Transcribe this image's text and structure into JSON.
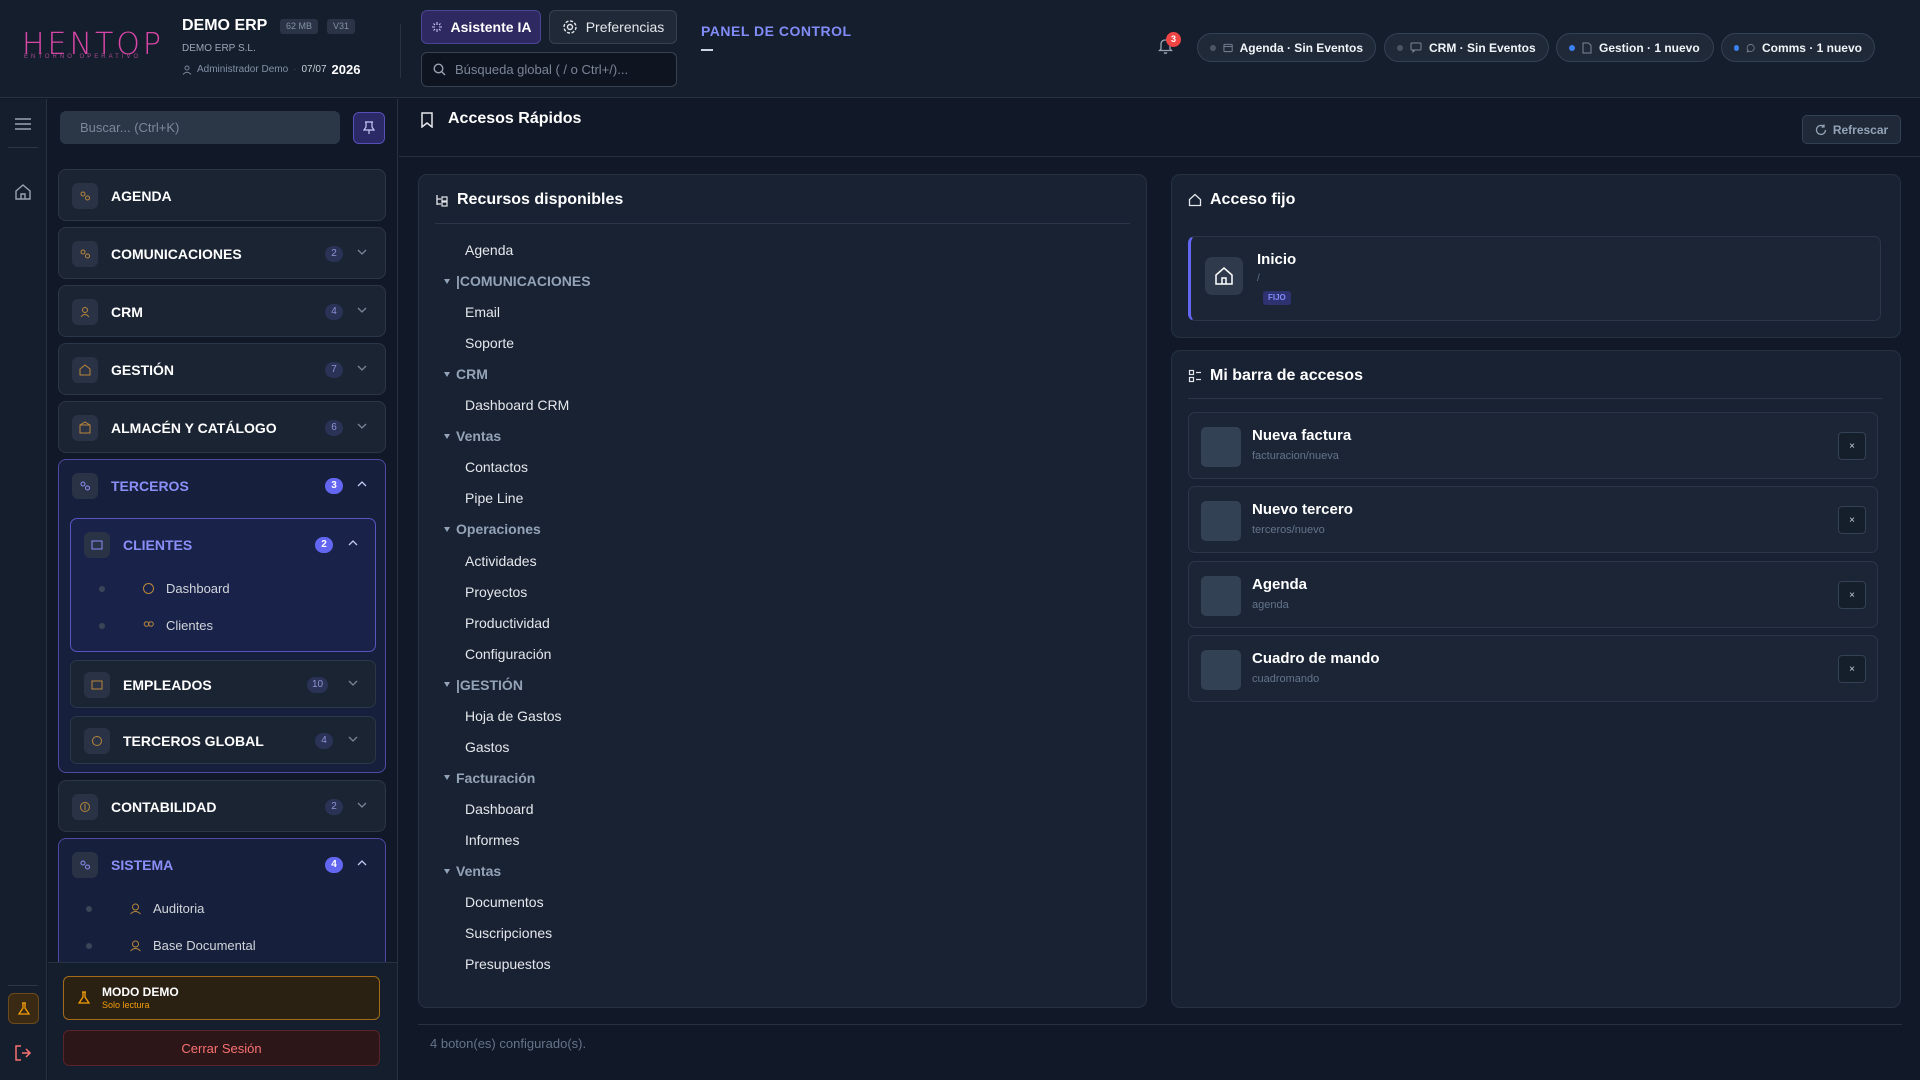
{
  "header": {
    "logo": "HENTOP",
    "logo_sub": "ENTORNO OPERATIVO",
    "erp_title": "DEMO ERP",
    "mem_chip": "62 MB",
    "ver_chip": "V31",
    "company": "DEMO ERP S.L.",
    "user": "Administrador Demo",
    "date": "07/07",
    "year": "2026",
    "ai_button": "Asistente IA",
    "pref_button": "Preferencias",
    "search_placeholder": "Búsqueda global ( / o Ctrl+/)...",
    "panel_title": "PANEL DE CONTROL",
    "notif_count": "3",
    "status": [
      {
        "label": "Agenda · Sin Eventos",
        "active": false
      },
      {
        "label": "CRM · Sin Eventos",
        "active": false
      },
      {
        "label": "Gestion · 1 nuevo",
        "active": true
      },
      {
        "label": "Comms · 1 nuevo",
        "active": true
      }
    ]
  },
  "sidebar": {
    "search_placeholder": "Buscar... (Ctrl+K)",
    "groups": [
      {
        "label": "AGENDA",
        "count": ""
      },
      {
        "label": "COMUNICACIONES",
        "count": "2"
      },
      {
        "label": "CRM",
        "count": "4"
      },
      {
        "label": "GESTIÓN",
        "count": "7"
      },
      {
        "label": "ALMACÉN Y CATÁLOGO",
        "count": "6"
      },
      {
        "label": "TERCEROS",
        "count": "3"
      },
      {
        "label": "CONTABILIDAD",
        "count": "2"
      },
      {
        "label": "SISTEMA",
        "count": "4"
      }
    ],
    "terceros_sub": [
      {
        "label": "CLIENTES",
        "count": "2"
      },
      {
        "label": "EMPLEADOS",
        "count": "10"
      },
      {
        "label": "TERCEROS GLOBAL",
        "count": "4"
      }
    ],
    "clientes_items": [
      "Dashboard",
      "Clientes"
    ],
    "sistema_items": [
      "Auditoria",
      "Base Documental"
    ],
    "demo_title": "MODO DEMO",
    "demo_sub": "Solo lectura",
    "logout": "Cerrar Sesión"
  },
  "main": {
    "title": "Accesos Rápidos",
    "refresh": "Refrescar",
    "resources": {
      "title": "Recursos disponibles",
      "tree": [
        {
          "kind": "item",
          "label": "Agenda"
        },
        {
          "kind": "group",
          "label": "|COMUNICACIONES"
        },
        {
          "kind": "item",
          "label": "Email"
        },
        {
          "kind": "item",
          "label": "Soporte"
        },
        {
          "kind": "group",
          "label": "CRM"
        },
        {
          "kind": "item",
          "label": "Dashboard CRM"
        },
        {
          "kind": "group",
          "label": "Ventas"
        },
        {
          "kind": "item",
          "label": "Contactos"
        },
        {
          "kind": "item",
          "label": "Pipe Line"
        },
        {
          "kind": "group",
          "label": "Operaciones"
        },
        {
          "kind": "item",
          "label": "Actividades"
        },
        {
          "kind": "item",
          "label": "Proyectos"
        },
        {
          "kind": "item",
          "label": "Productividad"
        },
        {
          "kind": "item",
          "label": "Configuración"
        },
        {
          "kind": "group",
          "label": "|GESTIÓN"
        },
        {
          "kind": "item",
          "label": "Hoja de Gastos"
        },
        {
          "kind": "item",
          "label": "Gastos"
        },
        {
          "kind": "group",
          "label": "Facturación"
        },
        {
          "kind": "item",
          "label": "Dashboard"
        },
        {
          "kind": "item",
          "label": "Informes"
        },
        {
          "kind": "group",
          "label": "Ventas"
        },
        {
          "kind": "item",
          "label": "Documentos"
        },
        {
          "kind": "item",
          "label": "Suscripciones"
        },
        {
          "kind": "item",
          "label": "Presupuestos"
        }
      ]
    },
    "fixed": {
      "title": "Acceso fijo",
      "item_title": "Inicio",
      "item_path": "/",
      "badge": "FIJO"
    },
    "bar": {
      "title": "Mi barra de accesos",
      "items": [
        {
          "title": "Nueva factura",
          "path": "facturacion/nueva"
        },
        {
          "title": "Nuevo tercero",
          "path": "terceros/nuevo"
        },
        {
          "title": "Agenda",
          "path": "agenda"
        },
        {
          "title": "Cuadro de mando",
          "path": "cuadromando"
        }
      ],
      "remove": "×"
    },
    "footer": "4 boton(es) configurado(s)."
  }
}
